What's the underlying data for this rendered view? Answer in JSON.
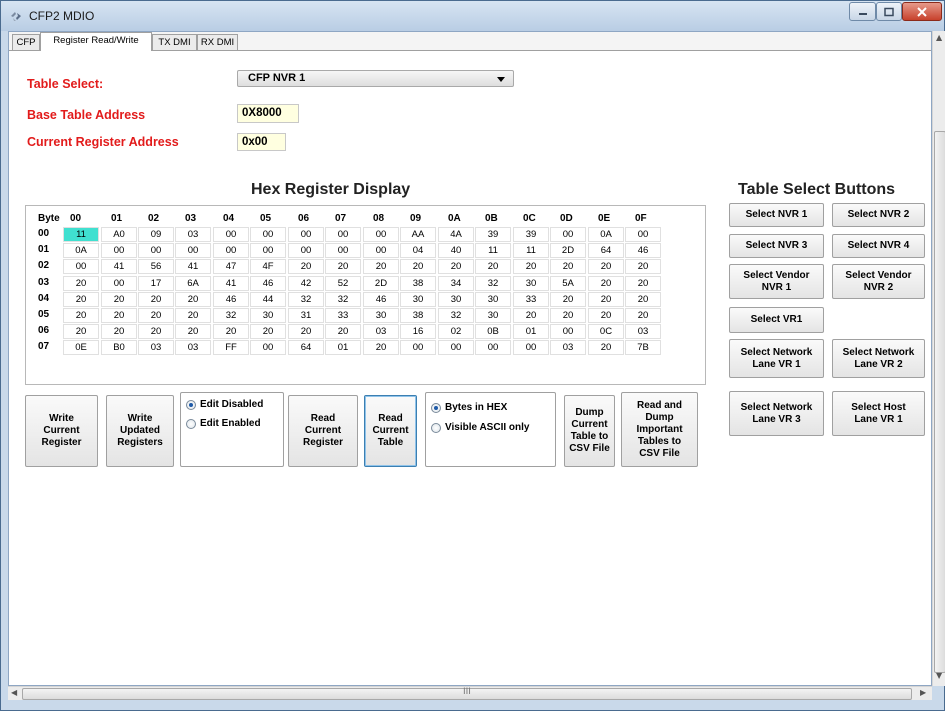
{
  "window": {
    "title": "CFP2 MDIO"
  },
  "tabs": [
    "CFP",
    "Register Read/Write",
    "TX DMI",
    "RX DMI"
  ],
  "form": {
    "table_select_label": "Table Select:",
    "table_select_value": "CFP NVR 1",
    "base_addr_label": "Base Table Address",
    "base_addr_value": "0X8000",
    "cur_addr_label": "Current Register Address",
    "cur_addr_value": "0x00"
  },
  "hex": {
    "title": "Hex Register Display",
    "corner": "Byte",
    "cols": [
      "00",
      "01",
      "02",
      "03",
      "04",
      "05",
      "06",
      "07",
      "08",
      "09",
      "0A",
      "0B",
      "0C",
      "0D",
      "0E",
      "0F"
    ],
    "rows": [
      {
        "label": "00",
        "values": [
          "11",
          "A0",
          "09",
          "03",
          "00",
          "00",
          "00",
          "00",
          "00",
          "AA",
          "4A",
          "39",
          "39",
          "00",
          "0A",
          "00"
        ]
      },
      {
        "label": "01",
        "values": [
          "0A",
          "00",
          "00",
          "00",
          "00",
          "00",
          "00",
          "00",
          "00",
          "04",
          "40",
          "11",
          "11",
          "2D",
          "64",
          "46"
        ]
      },
      {
        "label": "02",
        "values": [
          "00",
          "41",
          "56",
          "41",
          "47",
          "4F",
          "20",
          "20",
          "20",
          "20",
          "20",
          "20",
          "20",
          "20",
          "20",
          "20"
        ]
      },
      {
        "label": "03",
        "values": [
          "20",
          "00",
          "17",
          "6A",
          "41",
          "46",
          "42",
          "52",
          "2D",
          "38",
          "34",
          "32",
          "30",
          "5A",
          "20",
          "20"
        ]
      },
      {
        "label": "04",
        "values": [
          "20",
          "20",
          "20",
          "20",
          "46",
          "44",
          "32",
          "32",
          "46",
          "30",
          "30",
          "30",
          "33",
          "20",
          "20",
          "20"
        ]
      },
      {
        "label": "05",
        "values": [
          "20",
          "20",
          "20",
          "20",
          "32",
          "30",
          "31",
          "33",
          "30",
          "38",
          "32",
          "30",
          "20",
          "20",
          "20",
          "20"
        ]
      },
      {
        "label": "06",
        "values": [
          "20",
          "20",
          "20",
          "20",
          "20",
          "20",
          "20",
          "20",
          "03",
          "16",
          "02",
          "0B",
          "01",
          "00",
          "0C",
          "03"
        ]
      },
      {
        "label": "07",
        "values": [
          "0E",
          "B0",
          "03",
          "03",
          "FF",
          "00",
          "64",
          "01",
          "20",
          "00",
          "00",
          "00",
          "00",
          "03",
          "20",
          "7B"
        ]
      }
    ]
  },
  "actions": {
    "write_current": "Write\nCurrent\nRegister",
    "write_updated": "Write\nUpdated\nRegisters",
    "edit_disabled": "Edit Disabled",
    "edit_enabled": "Edit Enabled",
    "read_current_reg": "Read\nCurrent\nRegister",
    "read_current_table": "Read\nCurrent\nTable",
    "bytes_hex": "Bytes in HEX",
    "visible_ascii": "Visible ASCII only",
    "dump_current": "Dump\nCurrent\nTable to\nCSV File",
    "dump_important": "Read and\nDump\nImportant\nTables to\nCSV File"
  },
  "table_buttons": {
    "title": "Table Select Buttons",
    "nvr1": "Select NVR 1",
    "nvr2": "Select NVR 2",
    "nvr3": "Select NVR 3",
    "nvr4": "Select NVR 4",
    "vendor1": "Select Vendor\nNVR 1",
    "vendor2": "Select Vendor\nNVR 2",
    "vr1": "Select VR1",
    "netlane1": "Select Network\nLane VR 1",
    "netlane2": "Select Network\nLane VR 2",
    "netlane3": "Select Network\nLane VR 3",
    "hostlane1": "Select Host\nLane VR 1"
  },
  "hscroll_marker": "III"
}
